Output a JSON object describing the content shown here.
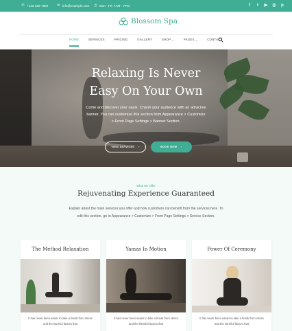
{
  "topbar": {
    "phone": "+123-456-7890",
    "email": "info@example.com",
    "hours": "Mon - Fri: 7AM - 7PM",
    "social": [
      {
        "icon": "facebook-icon",
        "glyph": "f"
      },
      {
        "icon": "twitter-icon",
        "glyph": "t"
      },
      {
        "icon": "youtube-icon",
        "glyph": "▶"
      },
      {
        "icon": "instagram-icon",
        "glyph": "◎"
      },
      {
        "icon": "pinterest-icon",
        "glyph": "p"
      }
    ]
  },
  "brand": {
    "name": "Blossom Spa",
    "color": "#3fae94"
  },
  "nav": [
    {
      "label": "HOME",
      "active": true,
      "dropdown": false
    },
    {
      "label": "SERVICES",
      "active": false,
      "dropdown": false
    },
    {
      "label": "PRICING",
      "active": false,
      "dropdown": false
    },
    {
      "label": "GALLERY",
      "active": false,
      "dropdown": false
    },
    {
      "label": "SHOP",
      "active": false,
      "dropdown": true
    },
    {
      "label": "PAGES",
      "active": false,
      "dropdown": true
    },
    {
      "label": "CONTACT",
      "active": false,
      "dropdown": false
    }
  ],
  "hero": {
    "title_line1": "Relaxing Is Never",
    "title_line2": "Easy On Your Own",
    "description": "Come and discover your oasis. Charm your audience with an attractive banner. You can customize this section from Appearance > Customize > Front Page Settings > Banner Section.",
    "button_primary": "VIEW SERVICES",
    "button_secondary": "BOOK NOW"
  },
  "services_section": {
    "eyebrow": "What We Offer",
    "title": "Rejuvenating Experience Guaranteed",
    "description": "Explain about the main services you offer and how customers can benefit from the services here. To edit this section, go to Appearance > Customize > Front Page Settings > Service Section.",
    "cards": [
      {
        "title": "The Method Relaxation",
        "text": "It has never been easier to take a break from stress and the harmful factors that"
      },
      {
        "title": "Yamas In Motion",
        "text": "It has never been easier to take a break from stress and the harmful factors that"
      },
      {
        "title": "Power Of Ceremony",
        "text": "It has never been easier to take a break from stress and the harmful factors that"
      }
    ]
  }
}
